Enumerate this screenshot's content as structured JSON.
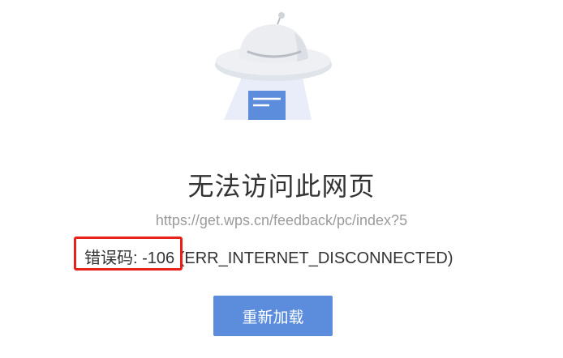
{
  "error_page": {
    "title": "无法访问此网页",
    "url": "https://get.wps.cn/feedback/pc/index?5",
    "error_code_label": "错误码: -106",
    "error_code_detail": " (ERR_INTERNET_DISCONNECTED)",
    "reload_button_label": "重新加载",
    "illustration_icon": "ufo-icon"
  },
  "colors": {
    "accent": "#5c8ddd",
    "highlight": "#e8211b",
    "title_text": "#333333",
    "url_text": "#9b9b9b"
  }
}
